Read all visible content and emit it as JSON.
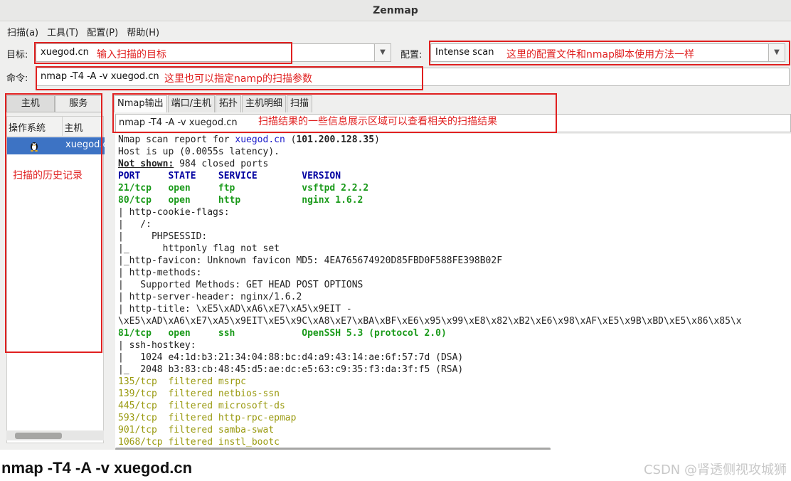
{
  "app": {
    "title": "Zenmap"
  },
  "menu": [
    "扫描(a)",
    "工具(T)",
    "配置(P)",
    "帮助(H)"
  ],
  "target": {
    "label": "目标:",
    "value": "xuegod.cn"
  },
  "profile": {
    "label": "配置:",
    "value": "Intense scan"
  },
  "command": {
    "label": "命令:",
    "value": "nmap -T4 -A -v xuegod.cn"
  },
  "left_tabs": [
    "主机",
    "服务"
  ],
  "host_list": {
    "columns": [
      "操作系统",
      "主机"
    ],
    "rows": [
      {
        "os_icon": "linux-penguin-icon",
        "host": "xuegod.c"
      }
    ]
  },
  "right_tabs": [
    "Nmap输出",
    "端口/主机",
    "拓扑",
    "主机明细",
    "扫描"
  ],
  "output_host_select": "nmap -T4 -A -v xuegod.cn",
  "output_lines": [
    {
      "segs": [
        [
          "Nmap scan report for ",
          ""
        ],
        [
          "xuegod.cn",
          "c-blue"
        ],
        [
          " (",
          ""
        ],
        [
          "101.200.128.35",
          "c-bold"
        ],
        [
          ")",
          ""
        ]
      ]
    },
    {
      "segs": [
        [
          "Host is up (0.0055s latency).",
          ""
        ]
      ]
    },
    {
      "segs": [
        [
          "Not shown:",
          "c-ul"
        ],
        [
          " 984 closed ports",
          ""
        ]
      ]
    },
    {
      "segs": [
        [
          "PORT     STATE    SERVICE        VERSION",
          "c-head"
        ]
      ]
    },
    {
      "segs": [
        [
          "21/tcp   open     ftp            vsftpd 2.2.2",
          "c-open"
        ]
      ]
    },
    {
      "segs": [
        [
          "80/tcp   open     http           nginx 1.6.2",
          "c-open"
        ]
      ]
    },
    {
      "segs": [
        [
          "| http-cookie-flags:",
          ""
        ]
      ]
    },
    {
      "segs": [
        [
          "|   /:",
          ""
        ]
      ]
    },
    {
      "segs": [
        [
          "|     PHPSESSID:",
          ""
        ]
      ]
    },
    {
      "segs": [
        [
          "|_      httponly flag not set",
          ""
        ]
      ]
    },
    {
      "segs": [
        [
          "|_http-favicon: Unknown favicon MD5: 4EA765674920D85FBD0F588FE398B02F",
          ""
        ]
      ]
    },
    {
      "segs": [
        [
          "| http-methods:",
          ""
        ]
      ]
    },
    {
      "segs": [
        [
          "|   Supported Methods: GET HEAD POST OPTIONS",
          ""
        ]
      ]
    },
    {
      "segs": [
        [
          "| http-server-header: nginx/1.6.2",
          ""
        ]
      ]
    },
    {
      "segs": [
        [
          "| http-title: \\xE5\\xAD\\xA6\\xE7\\xA5\\x9EIT -",
          ""
        ]
      ]
    },
    {
      "segs": [
        [
          "\\xE5\\xAD\\xA6\\xE7\\xA5\\x9EIT\\xE5\\x9C\\xA8\\xE7\\xBA\\xBF\\xE6\\x95\\x99\\xE8\\x82\\xB2\\xE6\\x98\\xAF\\xE5\\x9B\\xBD\\xE5\\x86\\x85\\x",
          ""
        ]
      ]
    },
    {
      "segs": [
        [
          "81/tcp   open     ssh            OpenSSH 5.3 (protocol 2.0)",
          "c-open"
        ]
      ]
    },
    {
      "segs": [
        [
          "| ssh-hostkey:",
          ""
        ]
      ]
    },
    {
      "segs": [
        [
          "|   1024 e4:1d:b3:21:34:04:88:bc:d4:a9:43:14:ae:6f:57:7d (DSA)",
          ""
        ]
      ]
    },
    {
      "segs": [
        [
          "|_  2048 b3:83:cb:48:45:d5:ae:dc:e5:63:c9:35:f3:da:3f:f5 (RSA)",
          ""
        ]
      ]
    },
    {
      "segs": [
        [
          "135/tcp  filtered msrpc",
          "c-filt"
        ]
      ]
    },
    {
      "segs": [
        [
          "139/tcp  filtered netbios-ssn",
          "c-filt"
        ]
      ]
    },
    {
      "segs": [
        [
          "445/tcp  filtered microsoft-ds",
          "c-filt"
        ]
      ]
    },
    {
      "segs": [
        [
          "593/tcp  filtered http-rpc-epmap",
          "c-filt"
        ]
      ]
    },
    {
      "segs": [
        [
          "901/tcp  filtered samba-swat",
          "c-filt"
        ]
      ]
    },
    {
      "segs": [
        [
          "1068/tcp filtered instl_bootc",
          "c-filt"
        ]
      ]
    }
  ],
  "annotations": {
    "target_note": "输入扫描的目标",
    "profile_note": "这里的配置文件和nmap脚本使用方法一样",
    "command_note": "这里也可以指定namp的扫描参数",
    "output_note": "扫描结果的一些信息展示区域可以查看相关的扫描结果",
    "history_note": "扫描的历史记录",
    "color": "#e02020"
  },
  "caption": "nmap -T4 -A -v xuegod.cn",
  "watermark": "CSDN @肾透侧视攻城狮"
}
